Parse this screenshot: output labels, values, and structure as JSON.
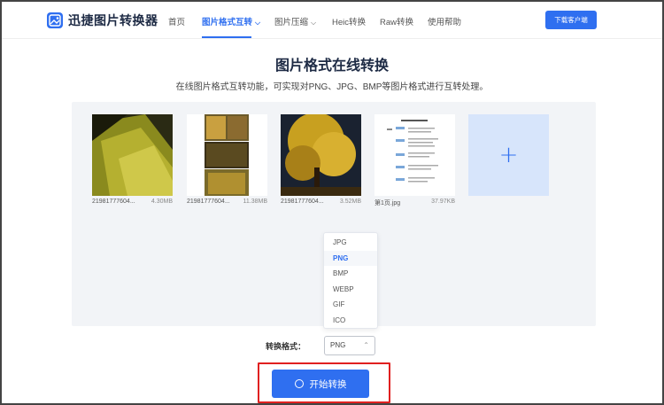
{
  "nav": {
    "brand": "迅捷图片转换器",
    "items": [
      {
        "label": "首页",
        "active": false,
        "dropdown": false
      },
      {
        "label": "图片格式互转",
        "active": true,
        "dropdown": true
      },
      {
        "label": "图片压缩",
        "active": false,
        "dropdown": true
      },
      {
        "label": "Heic转换",
        "active": false,
        "dropdown": false
      },
      {
        "label": "Raw转换",
        "active": false,
        "dropdown": false
      },
      {
        "label": "使用帮助",
        "active": false,
        "dropdown": false
      }
    ],
    "download_label": "下载客户端"
  },
  "header": {
    "title": "图片格式在线转换",
    "subtitle": "在线图片格式互转功能，可实现对PNG、JPG、BMP等图片格式进行互转处理。"
  },
  "files": [
    {
      "name": "21981777604...",
      "size": "4.30MB"
    },
    {
      "name": "21981777604...",
      "size": "11.38MB"
    },
    {
      "name": "21981777604...",
      "size": "3.52MB"
    },
    {
      "name": "第1页.jpg",
      "size": "37.97KB"
    }
  ],
  "format_dropdown": {
    "options": [
      "JPG",
      "PNG",
      "BMP",
      "WEBP",
      "GIF",
      "ICO"
    ],
    "selected": "PNG"
  },
  "convert": {
    "label": "转换格式：",
    "value": "PNG",
    "start_label": "开始转换"
  },
  "colors": {
    "accent": "#2f6ff0",
    "highlight": "#e02020",
    "area_bg": "#f2f4f7"
  }
}
